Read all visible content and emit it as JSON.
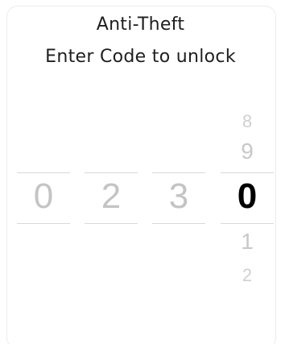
{
  "header": {
    "title": "Anti-Theft",
    "subtitle": "Enter Code to unlock"
  },
  "code_wheels": [
    {
      "selected": "0",
      "active": false
    },
    {
      "selected": "2",
      "active": false
    },
    {
      "selected": "3",
      "active": false
    },
    {
      "selected": "0",
      "active": true,
      "above": [
        "8",
        "9"
      ],
      "below": [
        "1",
        "2"
      ]
    }
  ],
  "colors": {
    "active_digit": "#000000",
    "inactive_digit": "#c4c4c4",
    "divider": "#d9d9d9"
  }
}
